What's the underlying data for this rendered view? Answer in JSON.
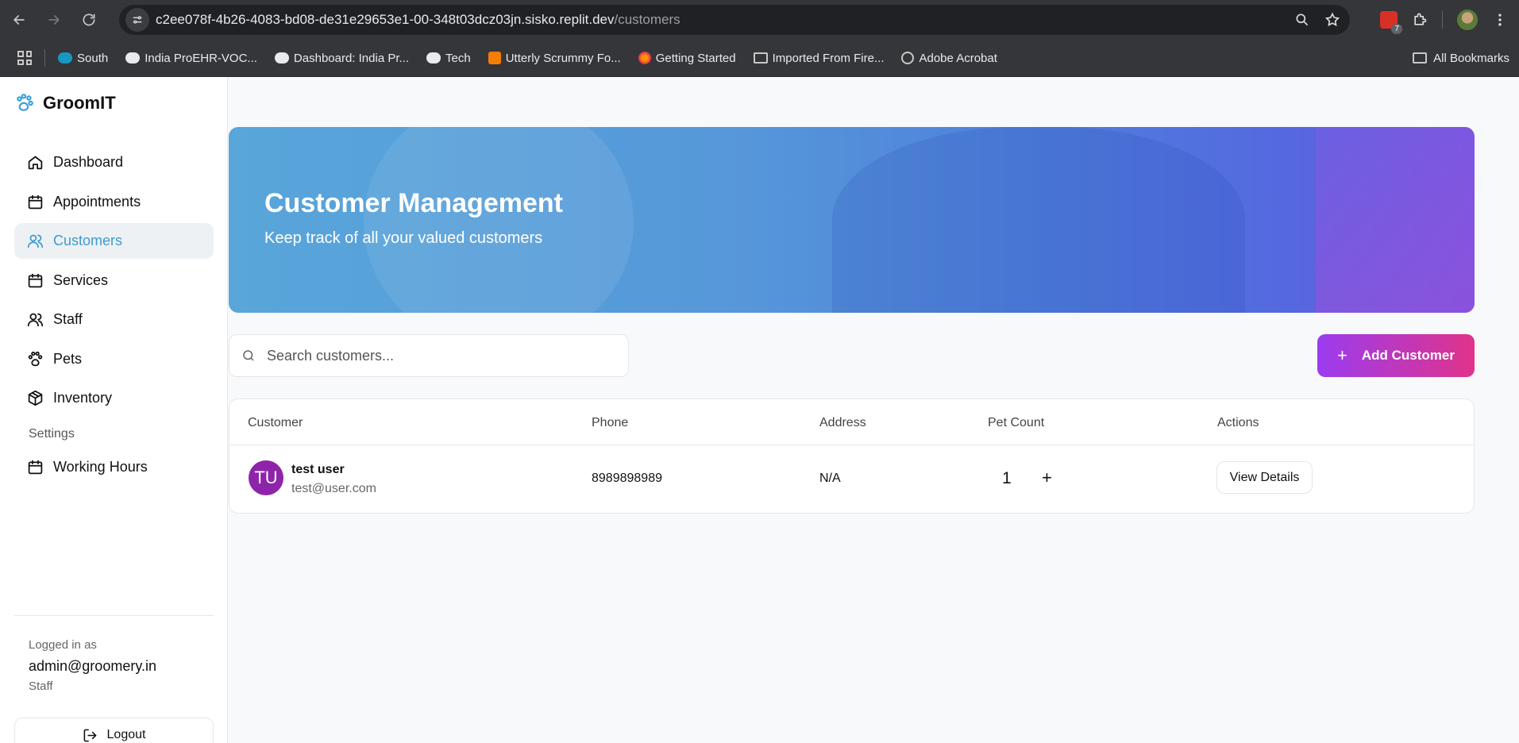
{
  "browser": {
    "url_host": "c2ee078f-4b26-4083-bd08-de31e29653e1-00-348t03dcz03jn.sisko.replit.dev",
    "url_path": "/customers",
    "extension_badge": "7",
    "bookmarks": [
      {
        "label": "South",
        "icon": "cloud-blue-icon"
      },
      {
        "label": "India ProEHR-VOC...",
        "icon": "cloud-icon"
      },
      {
        "label": "Dashboard: India Pr...",
        "icon": "cloud-icon"
      },
      {
        "label": "Tech",
        "icon": "cloud-icon"
      },
      {
        "label": "Utterly Scrummy Fo...",
        "icon": "blogger-icon"
      },
      {
        "label": "Getting Started",
        "icon": "firefox-icon"
      },
      {
        "label": "Imported From Fire...",
        "icon": "folder-icon"
      },
      {
        "label": "Adobe Acrobat",
        "icon": "globe-icon"
      }
    ],
    "all_bookmarks": "All Bookmarks"
  },
  "sidebar": {
    "brand": "GroomIT",
    "items": [
      {
        "label": "Dashboard",
        "icon": "home-icon"
      },
      {
        "label": "Appointments",
        "icon": "calendar-icon"
      },
      {
        "label": "Customers",
        "icon": "users-icon",
        "active": true
      },
      {
        "label": "Services",
        "icon": "calendar-icon"
      },
      {
        "label": "Staff",
        "icon": "users-icon"
      },
      {
        "label": "Pets",
        "icon": "paw-icon"
      },
      {
        "label": "Inventory",
        "icon": "package-icon"
      }
    ],
    "settings_heading": "Settings",
    "settings_items": [
      {
        "label": "Working Hours",
        "icon": "calendar-icon"
      }
    ],
    "footer": {
      "logged_in_label": "Logged in as",
      "email": "admin@groomery.in",
      "role": "Staff",
      "logout_label": "Logout"
    }
  },
  "hero": {
    "title": "Customer Management",
    "subtitle": "Keep track of all your valued customers"
  },
  "search": {
    "placeholder": "Search customers...",
    "value": ""
  },
  "add_button": "Add Customer",
  "table": {
    "columns": [
      "Customer",
      "Phone",
      "Address",
      "Pet Count",
      "Actions"
    ],
    "rows": [
      {
        "initials": "TU",
        "name": "test user",
        "email": "test@user.com",
        "phone": "8989898989",
        "address": "N/A",
        "pet_count": "1",
        "action": "View Details"
      }
    ]
  },
  "colors": {
    "accent": "#3d9bd1",
    "avatar": "#8e24aa",
    "button_gradient_start": "#9b3cf0",
    "button_gradient_end": "#e0338a"
  }
}
